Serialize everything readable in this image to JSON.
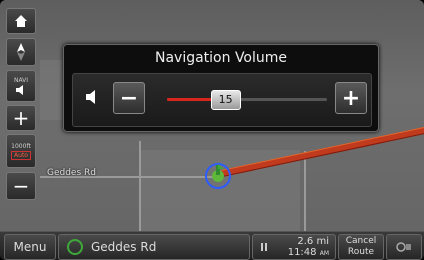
{
  "left_controls": {
    "home_icon": "home-icon",
    "compass_icon": "compass-icon",
    "navi_label": "NAVI",
    "zoom_in": "+",
    "scale_label": "1000ft",
    "auto_label": "Auto",
    "zoom_out": "−"
  },
  "dialog": {
    "title": "Navigation Volume",
    "minus_label": "−",
    "plus_label": "+",
    "volume_value": "15",
    "volume_fraction": 0.36
  },
  "map": {
    "road_name": "Geddes Rd"
  },
  "bottom_bar": {
    "menu_label": "Menu",
    "street_name": "Geddes Rd",
    "distance": "2.6 mi",
    "time": "11:48",
    "ampm": "AM",
    "cancel_label_line1": "Cancel",
    "cancel_label_line2": "Route"
  },
  "colors": {
    "route": "#c03a1e",
    "slider_fill": "#d8261c",
    "auto_text": "#ff5b3a"
  }
}
